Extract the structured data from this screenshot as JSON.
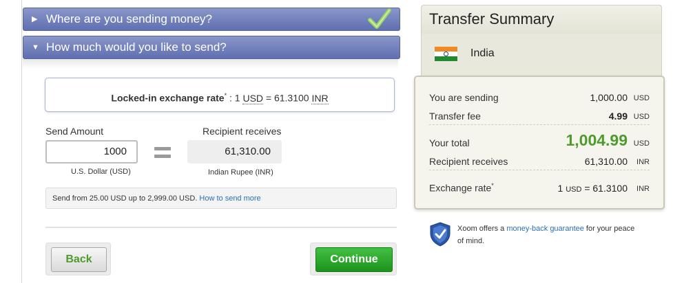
{
  "steps": {
    "step1": {
      "label": "Where are you sending money?",
      "completed": true
    },
    "step2": {
      "label": "How much would you like to send?"
    }
  },
  "rate": {
    "prefix": "Locked-in exchange rate",
    "asterisk": "*",
    "colon": " : 1 ",
    "from_currency": "USD",
    "equals": " = 61.3100 ",
    "to_currency": "INR"
  },
  "send": {
    "label": "Send Amount",
    "value": "1000",
    "currency_label": "U.S. Dollar (USD)"
  },
  "recipient": {
    "label": "Recipient receives",
    "value": "61,310.00",
    "currency_label": "Indian Rupee (INR)"
  },
  "limits": {
    "text": "Send from 25.00 USD up to 2,999.00 USD.",
    "link": "How to send more"
  },
  "buttons": {
    "back": "Back",
    "continue": "Continue"
  },
  "summary": {
    "title": "Transfer Summary",
    "country": "India",
    "rows": [
      {
        "label": "You are sending",
        "value": "1,000.00",
        "currency": "USD"
      },
      {
        "label": "Transfer fee",
        "value": "4.99",
        "currency": "USD"
      },
      {
        "label": "Your total",
        "value": "1,004.99",
        "currency": "USD"
      },
      {
        "label": "Recipient receives",
        "value": "61,310.00",
        "currency": "INR"
      },
      {
        "label": "Exchange rate",
        "asterisk": "*",
        "value_prefix": "1 ",
        "value_unit": "USD",
        "value_suffix": " = 61.3100",
        "currency": "INR"
      }
    ]
  },
  "guarantee": {
    "text1": "Xoom offers a ",
    "link": "money-back guarantee",
    "text2": " for your peace of mind."
  },
  "colors": {
    "header_blue": "#6b7bbd",
    "green": "#4f9a2e",
    "link": "#2a6fb7"
  }
}
